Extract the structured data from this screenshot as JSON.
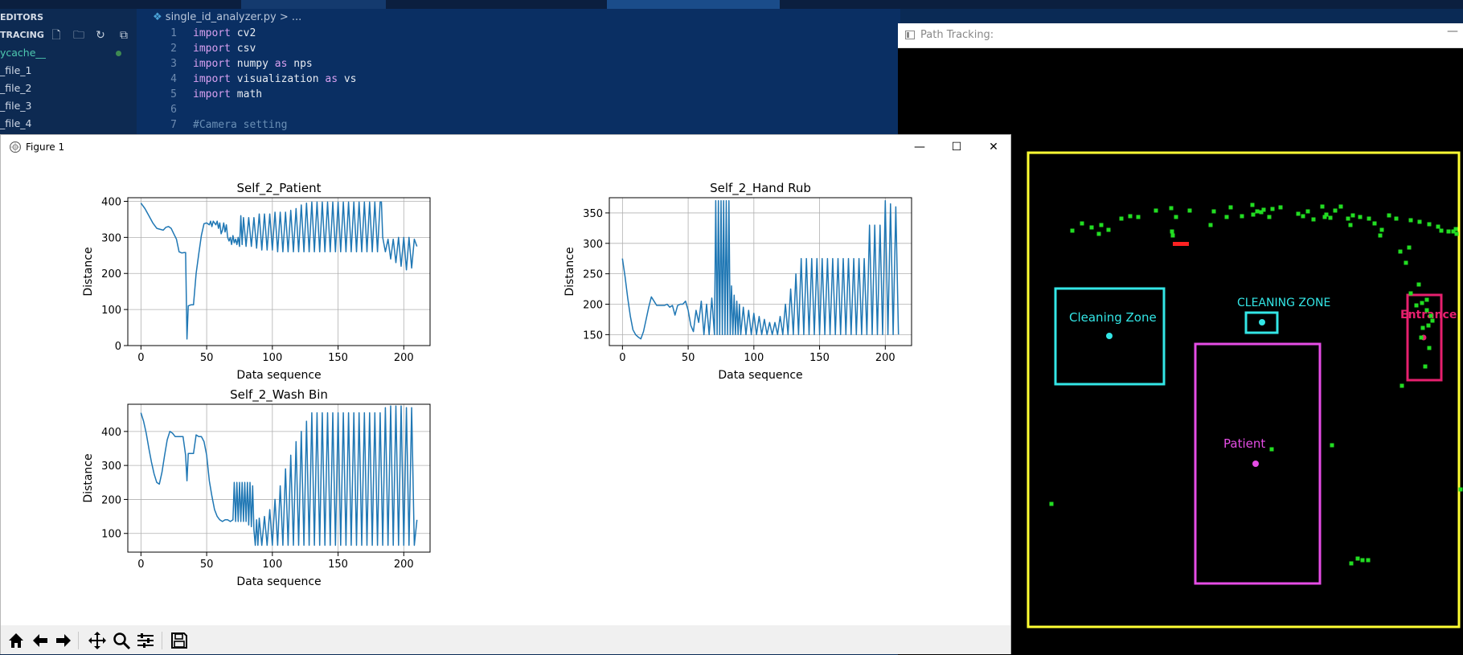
{
  "vscode": {
    "sidebar": {
      "section_editors": "EDITORS",
      "section_tracing": "TRACING",
      "items": [
        "ycache__",
        "_file_1",
        "_file_2",
        "_file_3",
        "_file_4"
      ]
    },
    "breadcrumb": {
      "file": "single_id_analyzer.py",
      "rest": "> ..."
    },
    "code_lines": [
      {
        "n": "1",
        "kw": "import",
        "text": "cv2",
        "kw2": "",
        "text2": ""
      },
      {
        "n": "2",
        "kw": "import",
        "text": "csv",
        "kw2": "",
        "text2": ""
      },
      {
        "n": "3",
        "kw": "import",
        "text": "numpy",
        "kw2": "as",
        "text2": "nps"
      },
      {
        "n": "4",
        "kw": "import",
        "text": "visualization",
        "kw2": "as",
        "text2": "vs"
      },
      {
        "n": "5",
        "kw": "import",
        "text": "math",
        "kw2": "",
        "text2": ""
      },
      {
        "n": "6",
        "kw": "",
        "text": "",
        "kw2": "",
        "text2": ""
      },
      {
        "n": "7",
        "kw": "",
        "text": "",
        "kw2": "",
        "text2": "",
        "comment": "#Camera setting"
      }
    ]
  },
  "path_window": {
    "title": "Path Tracking:",
    "zones": {
      "cleaning_zone": "Cleaning Zone",
      "cleaning_zone_upper": "CLEANING ZONE",
      "patient": "Patient",
      "entrance": "Entrance"
    },
    "colors": {
      "border": "#ffff33",
      "cleaning": "#33e6e6",
      "patient": "#e64de6",
      "entrance": "#e6206e",
      "points": "#22dd22",
      "marker": "#ff2222"
    }
  },
  "figure_window": {
    "title": "Figure 1",
    "controls": {
      "minimize": "—",
      "maximize": "☐",
      "close": "✕"
    },
    "toolbar": [
      "home-icon",
      "back-icon",
      "forward-icon",
      "pan-icon",
      "zoom-icon",
      "configure-icon",
      "save-icon"
    ]
  },
  "chart_data": [
    {
      "type": "line",
      "title": "Self_2_Patient",
      "xlabel": "Data sequence",
      "ylabel": "Distance",
      "xlim": [
        -10,
        220
      ],
      "ylim": [
        0,
        410
      ],
      "xticks": [
        0,
        50,
        100,
        150,
        200
      ],
      "yticks": [
        0,
        100,
        200,
        300,
        400
      ],
      "grid": true,
      "series": [
        {
          "color": "#1f77b4",
          "x": [
            0,
            3,
            6,
            9,
            12,
            15,
            17,
            19,
            21,
            23,
            25,
            27,
            29,
            31,
            33,
            34,
            35,
            36,
            38,
            40,
            42,
            44,
            46,
            48,
            50,
            52,
            53,
            54,
            55,
            56,
            57,
            58,
            59,
            60,
            61,
            62,
            63,
            64,
            65,
            66,
            67,
            68,
            69,
            70,
            71,
            72,
            73,
            74,
            75,
            76,
            77,
            78,
            80,
            82,
            84,
            86,
            88,
            90,
            92,
            94,
            96,
            98,
            100,
            102,
            104,
            106,
            108,
            110,
            112,
            114,
            116,
            118,
            120,
            122,
            124,
            126,
            128,
            130,
            132,
            134,
            136,
            138,
            140,
            142,
            144,
            146,
            148,
            150,
            152,
            154,
            156,
            158,
            160,
            162,
            164,
            166,
            168,
            170,
            172,
            174,
            176,
            178,
            180,
            182,
            183,
            184,
            186,
            188,
            190,
            192,
            194,
            196,
            198,
            200,
            202,
            204,
            206,
            208,
            210
          ],
          "y": [
            395,
            380,
            360,
            340,
            325,
            322,
            320,
            328,
            330,
            325,
            310,
            295,
            260,
            257,
            258,
            258,
            18,
            110,
            113,
            113,
            200,
            255,
            305,
            338,
            340,
            335,
            345,
            330,
            345,
            340,
            335,
            345,
            325,
            340,
            310,
            320,
            340,
            315,
            335,
            300,
            290,
            300,
            280,
            305,
            285,
            295,
            280,
            300,
            275,
            360,
            280,
            355,
            275,
            355,
            275,
            355,
            270,
            365,
            265,
            365,
            265,
            365,
            265,
            370,
            260,
            370,
            260,
            370,
            260,
            375,
            260,
            380,
            260,
            390,
            260,
            395,
            260,
            398,
            260,
            398,
            260,
            398,
            260,
            398,
            260,
            398,
            260,
            398,
            260,
            398,
            260,
            398,
            260,
            398,
            260,
            398,
            260,
            398,
            260,
            398,
            260,
            398,
            260,
            398,
            398,
            300,
            260,
            295,
            240,
            295,
            230,
            300,
            220,
            300,
            210,
            300,
            215,
            295,
            275
          ]
        }
      ]
    },
    {
      "type": "line",
      "title": "Self_2_Hand Rub",
      "xlabel": "Data sequence",
      "ylabel": "Distance",
      "xlim": [
        -10,
        220
      ],
      "ylim": [
        132,
        375
      ],
      "xticks": [
        0,
        50,
        100,
        150,
        200
      ],
      "yticks": [
        150,
        200,
        250,
        300,
        350
      ],
      "grid": true,
      "series": [
        {
          "color": "#1f77b4",
          "x": [
            0,
            2,
            4,
            6,
            8,
            10,
            12,
            14,
            16,
            18,
            20,
            22,
            24,
            26,
            28,
            30,
            32,
            34,
            36,
            38,
            40,
            42,
            44,
            46,
            48,
            50,
            52,
            54,
            56,
            58,
            60,
            62,
            64,
            66,
            68,
            70,
            71,
            72,
            73,
            74,
            75,
            76,
            77,
            78,
            79,
            80,
            81,
            82,
            83,
            84,
            85,
            86,
            87,
            88,
            89,
            90,
            92,
            94,
            96,
            98,
            100,
            102,
            104,
            106,
            108,
            110,
            112,
            114,
            116,
            118,
            120,
            122,
            124,
            126,
            128,
            130,
            132,
            134,
            136,
            138,
            140,
            142,
            144,
            146,
            148,
            150,
            152,
            154,
            156,
            158,
            160,
            162,
            164,
            166,
            168,
            170,
            172,
            174,
            176,
            178,
            180,
            182,
            184,
            186,
            188,
            190,
            192,
            194,
            196,
            198,
            200,
            202,
            204,
            206,
            208,
            210
          ],
          "y": [
            275,
            245,
            210,
            180,
            158,
            150,
            146,
            143,
            155,
            175,
            195,
            212,
            205,
            198,
            198,
            198,
            198,
            200,
            195,
            198,
            182,
            198,
            200,
            200,
            205,
            190,
            165,
            155,
            190,
            170,
            205,
            150,
            200,
            150,
            210,
            150,
            370,
            150,
            370,
            150,
            370,
            150,
            370,
            150,
            370,
            150,
            370,
            150,
            230,
            150,
            215,
            150,
            205,
            150,
            200,
            150,
            195,
            150,
            190,
            150,
            185,
            150,
            180,
            150,
            175,
            150,
            170,
            150,
            170,
            150,
            180,
            150,
            200,
            150,
            225,
            150,
            250,
            150,
            275,
            150,
            275,
            150,
            275,
            150,
            275,
            150,
            275,
            150,
            275,
            150,
            275,
            150,
            275,
            150,
            275,
            150,
            275,
            150,
            275,
            150,
            275,
            150,
            275,
            150,
            330,
            150,
            330,
            150,
            330,
            150,
            370,
            150,
            365,
            150,
            360,
            150
          ]
        }
      ]
    },
    {
      "type": "line",
      "title": "Self_2_Wash Bin",
      "xlabel": "Data sequence",
      "ylabel": "Distance",
      "xlim": [
        -10,
        220
      ],
      "ylim": [
        45,
        480
      ],
      "xticks": [
        0,
        50,
        100,
        150,
        200
      ],
      "yticks": [
        100,
        200,
        300,
        400
      ],
      "grid": true,
      "series": [
        {
          "color": "#1f77b4",
          "x": [
            0,
            2,
            4,
            6,
            8,
            10,
            12,
            14,
            16,
            18,
            20,
            22,
            24,
            26,
            28,
            30,
            32,
            34,
            35,
            36,
            38,
            40,
            42,
            44,
            46,
            48,
            50,
            52,
            54,
            56,
            58,
            60,
            62,
            64,
            66,
            68,
            70,
            71,
            72,
            73,
            74,
            75,
            76,
            77,
            78,
            79,
            80,
            81,
            82,
            83,
            84,
            85,
            86,
            87,
            88,
            89,
            90,
            92,
            94,
            96,
            98,
            100,
            102,
            104,
            106,
            108,
            110,
            112,
            114,
            116,
            118,
            120,
            122,
            124,
            126,
            128,
            130,
            132,
            134,
            136,
            138,
            140,
            142,
            144,
            146,
            148,
            150,
            152,
            154,
            156,
            158,
            160,
            162,
            164,
            166,
            168,
            170,
            172,
            174,
            176,
            178,
            180,
            182,
            184,
            186,
            188,
            190,
            192,
            194,
            196,
            198,
            200,
            202,
            204,
            206,
            208,
            210
          ],
          "y": [
            455,
            430,
            395,
            350,
            310,
            275,
            250,
            245,
            280,
            330,
            375,
            400,
            395,
            385,
            385,
            385,
            385,
            330,
            255,
            335,
            335,
            335,
            390,
            385,
            385,
            370,
            330,
            255,
            210,
            170,
            150,
            140,
            135,
            140,
            140,
            135,
            140,
            250,
            135,
            250,
            135,
            250,
            135,
            250,
            135,
            250,
            135,
            250,
            125,
            250,
            120,
            240,
            110,
            65,
            140,
            65,
            145,
            65,
            150,
            65,
            170,
            65,
            200,
            65,
            240,
            65,
            290,
            65,
            330,
            65,
            370,
            65,
            400,
            65,
            430,
            65,
            455,
            65,
            455,
            65,
            455,
            65,
            455,
            65,
            455,
            65,
            455,
            65,
            455,
            65,
            455,
            65,
            455,
            65,
            455,
            65,
            455,
            65,
            455,
            65,
            455,
            65,
            455,
            65,
            470,
            65,
            475,
            65,
            475,
            65,
            475,
            65,
            470,
            65,
            470,
            65,
            140
          ]
        }
      ]
    }
  ]
}
